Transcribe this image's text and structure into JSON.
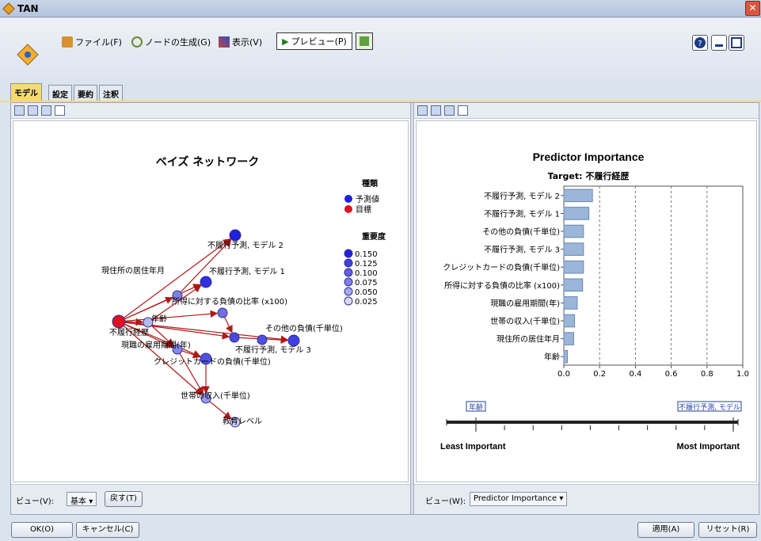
{
  "window": {
    "title": "TAN"
  },
  "menu": {
    "file": "ファイル(F)",
    "generate": "ノードの生成(G)",
    "view": "表示(V)",
    "preview": "プレビュー(P)"
  },
  "tabs": [
    {
      "label": "モデル"
    },
    {
      "label": "設定"
    },
    {
      "label": "要約"
    },
    {
      "label": "注釈"
    }
  ],
  "left": {
    "title": "ベイズ ネットワーク",
    "legend_kind_title": "種類",
    "legend_kind": [
      {
        "label": "予測値",
        "color": "#2020e0"
      },
      {
        "label": "目標",
        "color": "#e01020"
      }
    ],
    "legend_imp_title": "重要度",
    "legend_imp": [
      "0.150",
      "0.125",
      "0.100",
      "0.075",
      "0.050",
      "0.025"
    ],
    "nodes": [
      {
        "id": "target",
        "label": "不履行経歴"
      },
      {
        "id": "m2",
        "label": "不履行予測, モデル 2"
      },
      {
        "id": "m1",
        "label": "不履行予測, モデル 1"
      },
      {
        "id": "res",
        "label": "現住所の居住年月"
      },
      {
        "id": "ratio",
        "label": "所得に対する負債の比率 (x100)"
      },
      {
        "id": "age",
        "label": "年齢"
      },
      {
        "id": "other",
        "label": "その他の負債(千単位)"
      },
      {
        "id": "emp",
        "label": "現職の雇用期間(年)"
      },
      {
        "id": "m3",
        "label": "不履行予測, モデル 3"
      },
      {
        "id": "card",
        "label": "クレジットカードの負債(千単位)"
      },
      {
        "id": "income",
        "label": "世帯の収入(千単位)"
      },
      {
        "id": "edu",
        "label": "教育レベル"
      }
    ],
    "view_label": "ビュー(V):",
    "view_value": "基本",
    "reset_label": "戻す(T)"
  },
  "right": {
    "view_label": "ビュー(W):",
    "view_value": "Predictor Importance",
    "least": "Least Important",
    "most": "Most Important",
    "slider_left": "年齢",
    "slider_right": "不履行予測, モデル"
  },
  "chart_data": {
    "type": "bar",
    "title": "Predictor Importance",
    "subtitle": "Target: 不履行経歴",
    "categories": [
      "不履行予測, モデル 2",
      "不履行予測, モデル 1",
      "その他の負債(千単位)",
      "不履行予測, モデル 3",
      "クレジットカードの負債(千単位)",
      "所得に対する負債の比率 (x100)",
      "現職の雇用期間(年)",
      "世帯の収入(千単位)",
      "現住所の居住年月",
      "年齢"
    ],
    "values": [
      0.16,
      0.14,
      0.11,
      0.11,
      0.11,
      0.105,
      0.075,
      0.06,
      0.055,
      0.02
    ],
    "xlim": [
      0,
      1.0
    ],
    "xticks": [
      "0.0",
      "0.2",
      "0.4",
      "0.6",
      "0.8",
      "1.0"
    ],
    "bar_color": "#9ab6d8"
  },
  "footer": {
    "ok": "OK(O)",
    "cancel": "キャンセル(C)",
    "apply": "適用(A)",
    "reset": "リセット(R)"
  }
}
